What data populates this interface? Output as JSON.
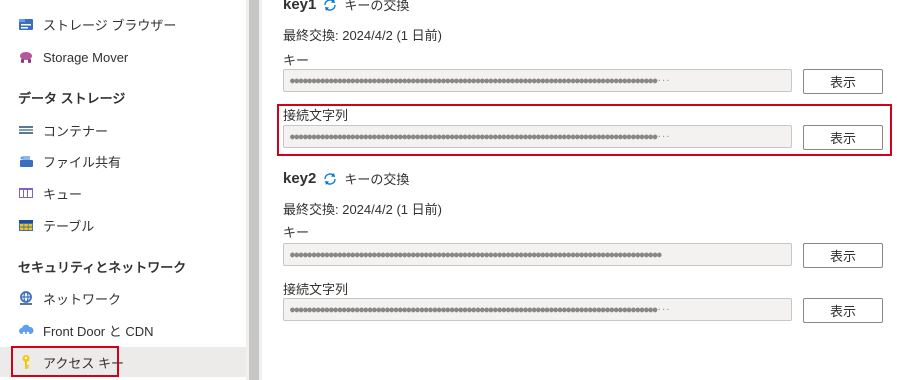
{
  "sidebar": {
    "items_top": [
      {
        "label": "ストレージ ブラウザー",
        "icon": "storage-browser-icon"
      },
      {
        "label": "Storage Mover",
        "icon": "storage-mover-icon"
      }
    ],
    "section_data_storage": "データ ストレージ",
    "data_storage_items": [
      {
        "label": "コンテナー",
        "icon": "container-icon"
      },
      {
        "label": "ファイル共有",
        "icon": "file-share-icon"
      },
      {
        "label": "キュー",
        "icon": "queue-icon"
      },
      {
        "label": "テーブル",
        "icon": "table-icon"
      }
    ],
    "section_security": "セキュリティとネットワーク",
    "security_items": [
      {
        "label": "ネットワーク",
        "icon": "network-icon"
      },
      {
        "label": "Front Door と CDN",
        "icon": "cloud-icon"
      },
      {
        "label": "アクセス キー",
        "icon": "key-icon",
        "selected": true
      }
    ]
  },
  "main": {
    "key1": {
      "title": "key1",
      "rotate_label": "キーの交換",
      "last_rotated": "最終交換: 2024/4/2 (1 日前)",
      "key_label": "キー",
      "key_value": "●●●●●●●●●●●●●●●●●●●●●●●●●●●●●●●●●●●●●●●●●●●●●●●●●●●●●●●●●●●●●●●●●●●●●●●●●●●●●●●●●●●●●···",
      "connection_label": "接続文字列",
      "connection_value": "●●●●●●●●●●●●●●●●●●●●●●●●●●●●●●●●●●●●●●●●●●●●●●●●●●●●●●●●●●●●●●●●●●●●●●●●●●●●●●●●●●●●●···"
    },
    "key2": {
      "title": "key2",
      "rotate_label": "キーの交換",
      "last_rotated": "最終交換: 2024/4/2 (1 日前)",
      "key_label": "キー",
      "key_value": "●●●●●●●●●●●●●●●●●●●●●●●●●●●●●●●●●●●●●●●●●●●●●●●●●●●●●●●●●●●●●●●●●●●●●●●●●●●●●●●●●●●●●●",
      "connection_label": "接続文字列",
      "connection_value": "●●●●●●●●●●●●●●●●●●●●●●●●●●●●●●●●●●●●●●●●●●●●●●●●●●●●●●●●●●●●●●●●●●●●●●●●●●●●●●●●●●●●●···"
    },
    "show_button_label": "表示"
  },
  "colors": {
    "highlight_red": "#d0021b",
    "accent_blue": "#0078d4",
    "key_yellow": "#f2c811"
  }
}
